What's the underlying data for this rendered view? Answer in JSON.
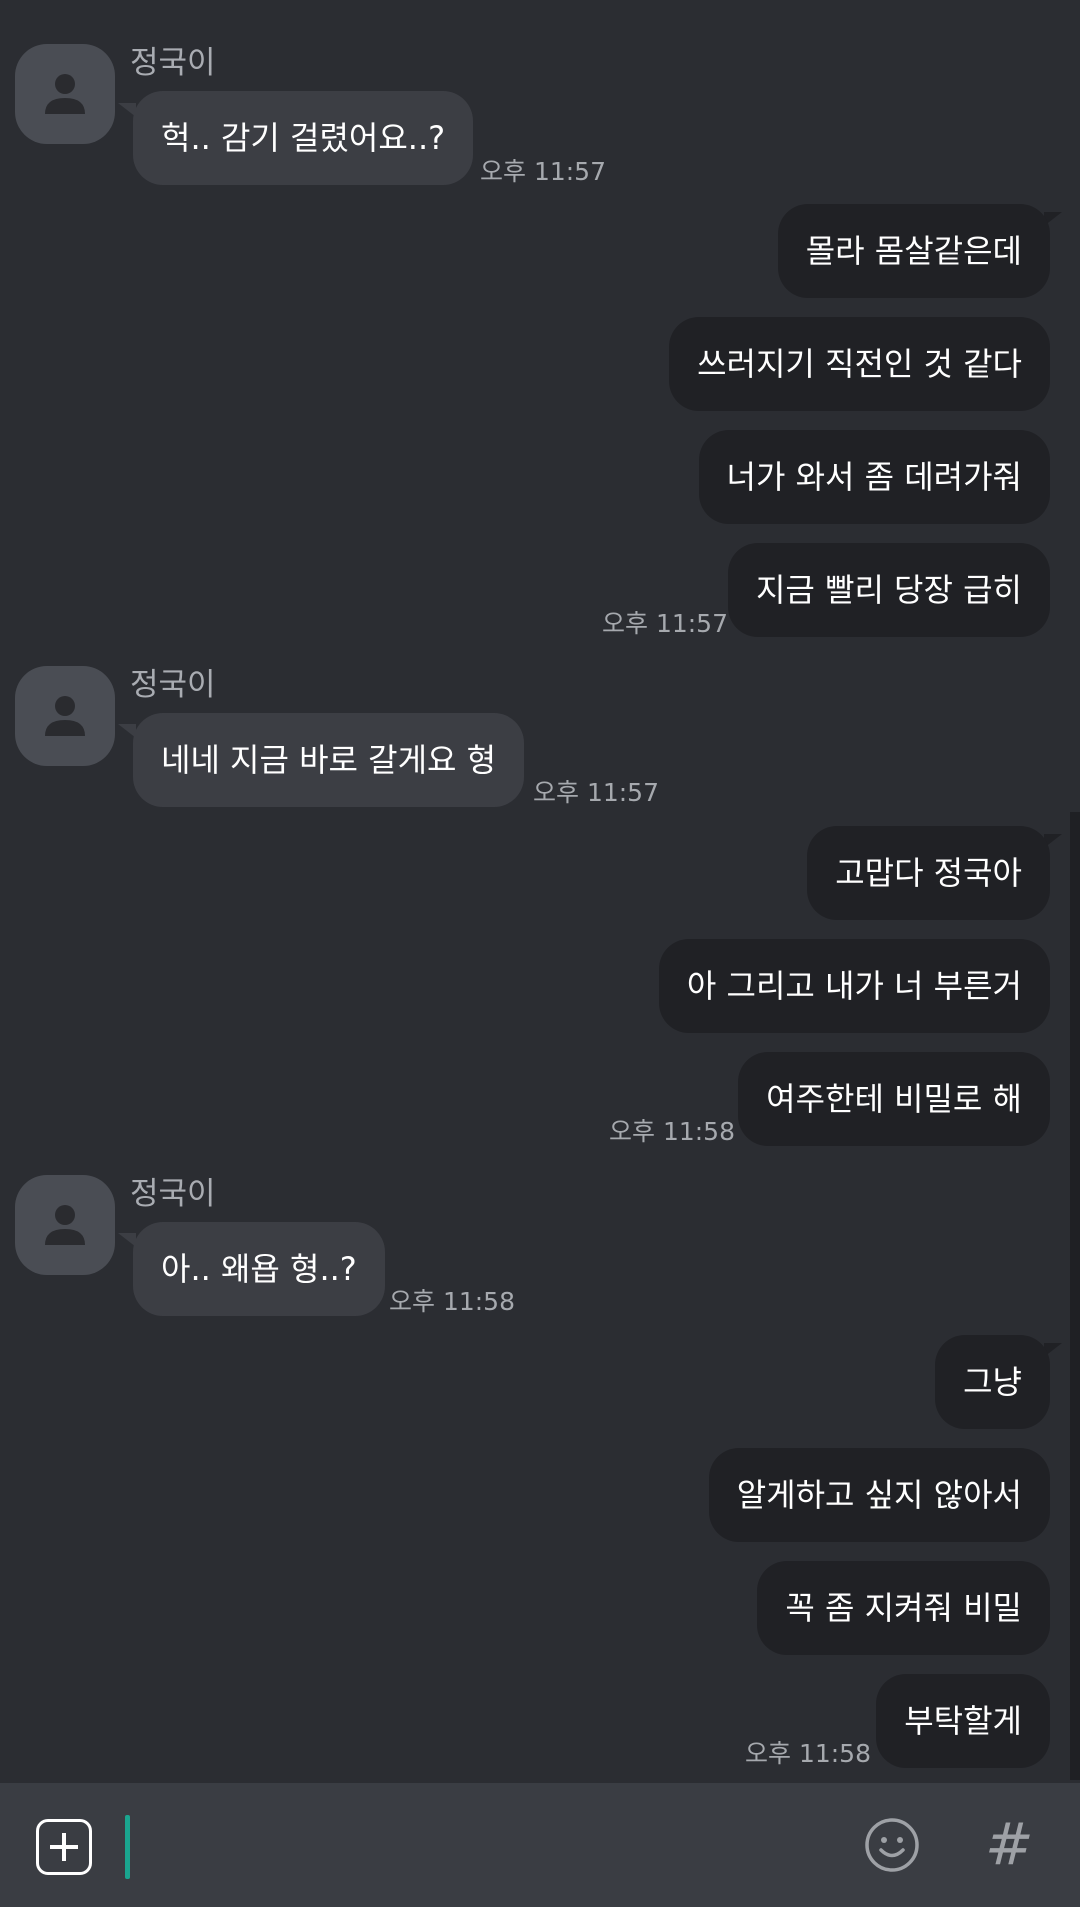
{
  "chat": {
    "contact_name": "정국이",
    "groups": [
      {
        "sender": "in",
        "name": "정국이",
        "messages": [
          "헉.. 감기 걸렸어요..?"
        ],
        "time": "오후 11:57"
      },
      {
        "sender": "out",
        "messages": [
          "몰라 몸살같은데",
          "쓰러지기 직전인 것 같다",
          "너가 와서 좀 데려가줘",
          "지금 빨리 당장 급히"
        ],
        "time": "오후 11:57"
      },
      {
        "sender": "in",
        "name": "정국이",
        "messages": [
          "네네 지금 바로 갈게요 형"
        ],
        "time": "오후 11:57"
      },
      {
        "sender": "out",
        "messages": [
          "고맙다 정국아",
          "아 그리고 내가 너 부른거",
          "여주한테 비밀로 해"
        ],
        "time": "오후 11:58"
      },
      {
        "sender": "in",
        "name": "정국이",
        "messages": [
          "아.. 왜욥 형..?"
        ],
        "time": "오후 11:58"
      },
      {
        "sender": "out",
        "messages": [
          "그냥",
          "알게하고 싶지 않아서",
          "꼭 좀 지켜줘 비밀",
          "부탁할게"
        ],
        "time": "오후 11:58"
      }
    ]
  },
  "composer": {
    "attach_icon": "plus-square-icon",
    "emoji_icon": "smiley-icon",
    "hash_label": "#"
  },
  "colors": {
    "background": "#2b2d32",
    "incoming_bubble": "#3c3e44",
    "outgoing_bubble": "#202125",
    "cursor": "#1aa58f"
  }
}
